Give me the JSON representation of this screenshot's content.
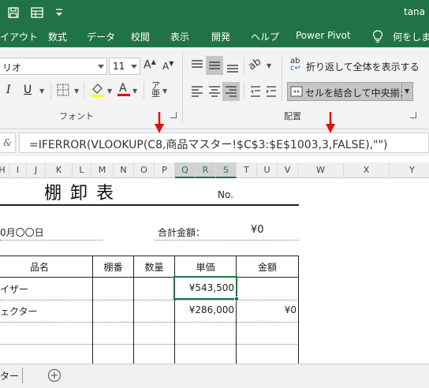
{
  "titlebar": {
    "user": "tana"
  },
  "ribbon_tabs": [
    "イアウト",
    "数式",
    "データ",
    "校閲",
    "表示",
    "開発",
    "ヘルプ",
    "Power Pivot",
    "何をします"
  ],
  "font_group": {
    "font_name": "リオ",
    "font_size": "11",
    "label": "フォント"
  },
  "alignment_group": {
    "wrap_text": "折り返して全体を表示する",
    "merge_center": "セルを結合して中央揃え",
    "label": "配置"
  },
  "formula_bar": {
    "fx": "&",
    "formula": "=IFERROR(VLOOKUP(C8,商品マスター!$C$3:$E$1003,3,FALSE),\"\")"
  },
  "columns": [
    "H",
    "I",
    "J",
    "K",
    "L",
    "M",
    "N",
    "O",
    "P",
    "Q",
    "R",
    "S",
    "T",
    "U",
    "V",
    "W",
    "X",
    "Y"
  ],
  "sheet": {
    "title": "棚 卸 表",
    "no_label": "No.",
    "date": "0月〇〇日",
    "total_label": "合計金額：",
    "total_value": "¥0",
    "table_headers": [
      "品名",
      "棚番",
      "数量",
      "単価",
      "金額"
    ],
    "rows": [
      {
        "name": "イザー",
        "price": "¥543,500",
        "amount": ""
      },
      {
        "name": "ェクター",
        "price": "¥286,000",
        "amount": "¥0"
      },
      {
        "name": "",
        "price": "",
        "amount": ""
      },
      {
        "name": "",
        "price": "",
        "amount": ""
      }
    ]
  },
  "sheet_tabs": {
    "current": "ター"
  },
  "colors": {
    "excel_green": "#217346",
    "arrow_red": "#e01010"
  },
  "icons": [
    "save-icon",
    "table-icon",
    "qat-more-icon",
    "lightbulb-icon",
    "increase-font-icon",
    "decrease-font-icon",
    "italic-icon",
    "underline-icon",
    "borders-icon",
    "fill-color-icon",
    "font-color-icon",
    "phonetic-icon",
    "align-top-icon",
    "align-middle-icon",
    "align-bottom-icon",
    "orientation-icon",
    "align-left-icon",
    "align-center-icon",
    "align-right-icon",
    "wrap-text-icon",
    "merge-center-icon",
    "add-sheet-icon",
    "red-arrow-icon"
  ]
}
